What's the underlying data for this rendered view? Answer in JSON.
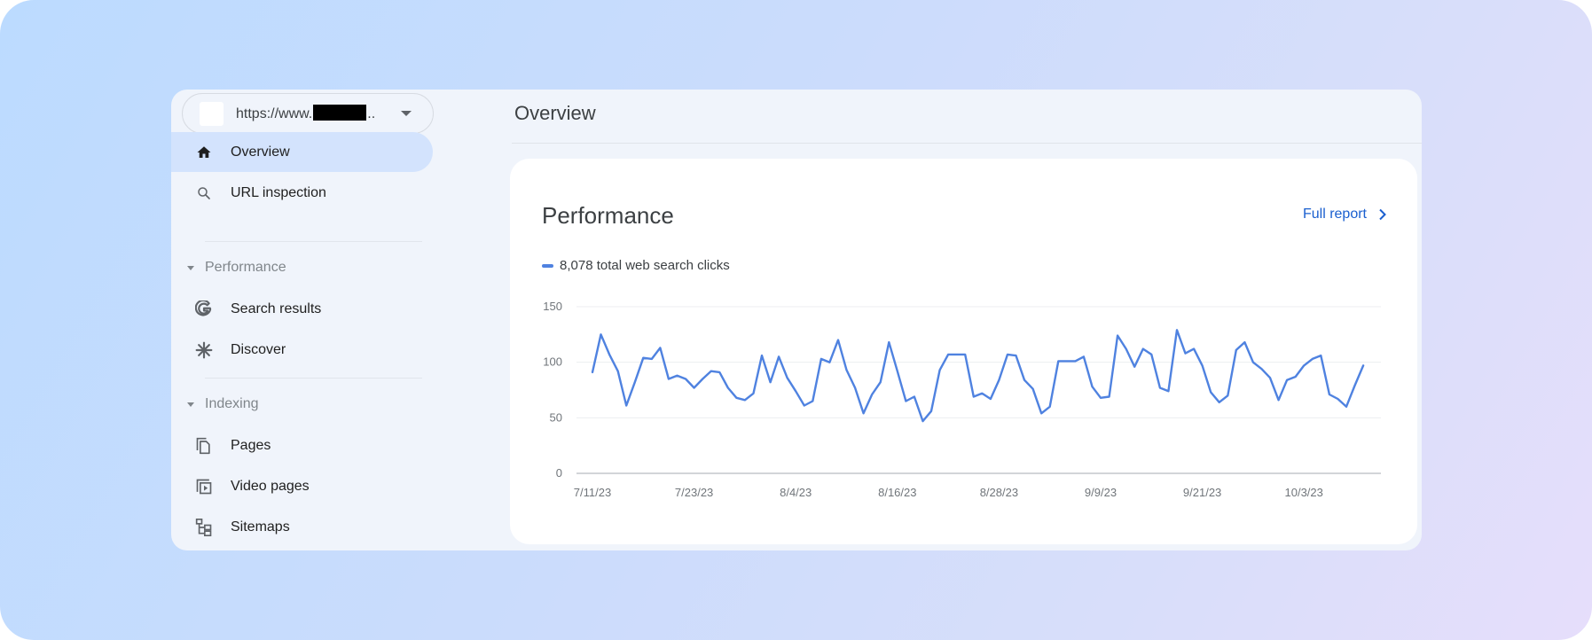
{
  "sidebar": {
    "property_url": "https://www.",
    "property_url_suffix": "..",
    "items": [
      {
        "label": "Overview",
        "icon": "home-icon",
        "active": true
      },
      {
        "label": "URL inspection",
        "icon": "search-icon"
      }
    ],
    "sections": [
      {
        "label": "Performance",
        "items": [
          {
            "label": "Search results",
            "icon": "google-g-icon"
          },
          {
            "label": "Discover",
            "icon": "asterisk-icon"
          }
        ]
      },
      {
        "label": "Indexing",
        "items": [
          {
            "label": "Pages",
            "icon": "pages-icon"
          },
          {
            "label": "Video pages",
            "icon": "video-pages-icon"
          },
          {
            "label": "Sitemaps",
            "icon": "sitemap-icon"
          }
        ]
      }
    ]
  },
  "header": {
    "title": "Overview"
  },
  "card": {
    "title": "Performance",
    "full_report_label": "Full report",
    "legend_label": "8,078 total web search clicks"
  },
  "colors": {
    "accent": "#1a5fcf",
    "series": "#4f82e0",
    "active_nav": "#d3e3fd"
  },
  "chart_data": {
    "type": "line",
    "title": "Performance",
    "xlabel": "",
    "ylabel": "",
    "ylim": [
      0,
      150
    ],
    "yticks": [
      0,
      50,
      100,
      150
    ],
    "xtick_labels": [
      "7/11/23",
      "7/23/23",
      "8/4/23",
      "8/16/23",
      "8/28/23",
      "9/9/23",
      "9/21/23",
      "10/3/23"
    ],
    "xtick_day_index": [
      0,
      12,
      24,
      36,
      48,
      60,
      72,
      84
    ],
    "grid": true,
    "legend": "top-left",
    "series": [
      {
        "name": "8,078 total web search clicks",
        "start_date": "7/11/23",
        "interval": "daily",
        "values": [
          91,
          125,
          107,
          92,
          61,
          82,
          104,
          103,
          113,
          85,
          88,
          85,
          77,
          85,
          92,
          91,
          77,
          68,
          66,
          72,
          106,
          82,
          105,
          86,
          74,
          61,
          65,
          103,
          100,
          120,
          93,
          77,
          54,
          71,
          82,
          118,
          92,
          65,
          69,
          47,
          56,
          93,
          107,
          107,
          107,
          69,
          72,
          67,
          84,
          107,
          106,
          84,
          76,
          54,
          60,
          101,
          101,
          101,
          105,
          78,
          68,
          69,
          124,
          112,
          96,
          112,
          107,
          77,
          74,
          129,
          108,
          112,
          97,
          73,
          64,
          70,
          111,
          118,
          100,
          94,
          86,
          66,
          84,
          87,
          97,
          103,
          106,
          71,
          67,
          60,
          79,
          97
        ]
      }
    ]
  }
}
